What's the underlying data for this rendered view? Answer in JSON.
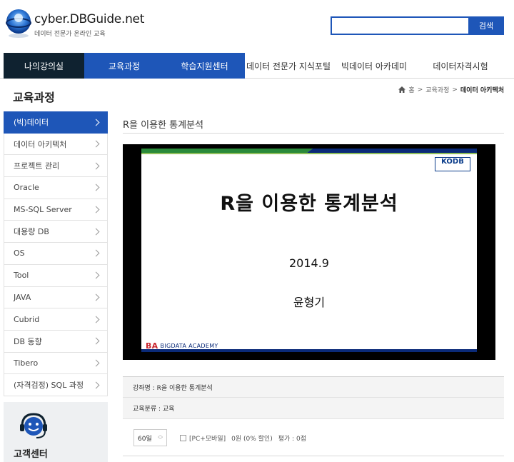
{
  "header": {
    "site_title": "cyber.DBGuide.net",
    "site_subtitle": "데이터 전문가 온라인 교육",
    "search_placeholder": "",
    "search_button": "검색"
  },
  "nav": {
    "items": [
      {
        "label": "나의강의실"
      },
      {
        "label": "교육과정"
      },
      {
        "label": "학습지원센터"
      },
      {
        "label": "데이터 전문가 지식포털"
      },
      {
        "label": "빅데이터 아카데미"
      },
      {
        "label": "데이터자격시험"
      }
    ]
  },
  "page": {
    "title": "교육과정",
    "breadcrumb": [
      "홈",
      "교육과정",
      "데이터 아키텍처"
    ]
  },
  "sidebar": {
    "items": [
      {
        "label": "(빅)데이터"
      },
      {
        "label": "데이터 아키텍처"
      },
      {
        "label": "프로젝트 관리"
      },
      {
        "label": "Oracle"
      },
      {
        "label": "MS-SQL Server"
      },
      {
        "label": "대용량 DB"
      },
      {
        "label": "OS"
      },
      {
        "label": "Tool"
      },
      {
        "label": "JAVA"
      },
      {
        "label": "Cubrid"
      },
      {
        "label": "DB 동향"
      },
      {
        "label": "Tibero"
      },
      {
        "label": "(자격검정) SQL 과정"
      }
    ],
    "customer_center": "고객센터"
  },
  "course": {
    "title": "R을 이용한 통계분석",
    "slide": {
      "title": "R을 이용한 통계분석",
      "date": "2014.9",
      "author": "윤형기",
      "brand": "BIGDATA ACADEMY",
      "brand_mark": "BA",
      "logo": "KODB"
    },
    "info": {
      "name": "강좌명 : R을 이용한 통계분석",
      "category": "교육분류 : 교육"
    },
    "options": {
      "period": "60일",
      "pc_mobile": "[PC+모바일]",
      "price": "0원 (0% 할인)",
      "rating": "평가 : 0점"
    }
  },
  "colors": {
    "brand_blue": "#1e56b8",
    "nav_dark": "#0f2230",
    "slide_green": "#2a8a3a",
    "slide_navy": "#0a2a78"
  }
}
